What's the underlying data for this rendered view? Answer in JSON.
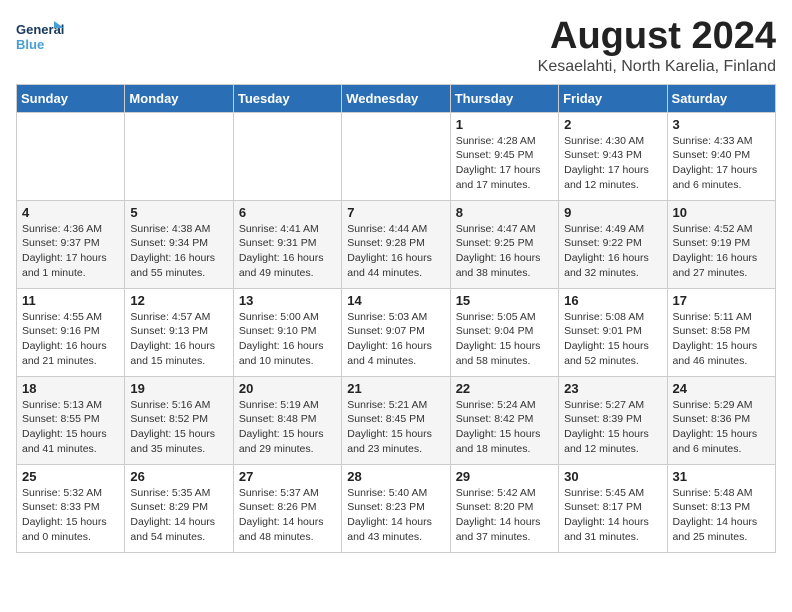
{
  "logo": {
    "line1": "General",
    "line2": "Blue"
  },
  "title": "August 2024",
  "subtitle": "Kesaelahti, North Karelia, Finland",
  "weekdays": [
    "Sunday",
    "Monday",
    "Tuesday",
    "Wednesday",
    "Thursday",
    "Friday",
    "Saturday"
  ],
  "weeks": [
    [
      {
        "day": "",
        "info": ""
      },
      {
        "day": "",
        "info": ""
      },
      {
        "day": "",
        "info": ""
      },
      {
        "day": "",
        "info": ""
      },
      {
        "day": "1",
        "info": "Sunrise: 4:28 AM\nSunset: 9:45 PM\nDaylight: 17 hours\nand 17 minutes."
      },
      {
        "day": "2",
        "info": "Sunrise: 4:30 AM\nSunset: 9:43 PM\nDaylight: 17 hours\nand 12 minutes."
      },
      {
        "day": "3",
        "info": "Sunrise: 4:33 AM\nSunset: 9:40 PM\nDaylight: 17 hours\nand 6 minutes."
      }
    ],
    [
      {
        "day": "4",
        "info": "Sunrise: 4:36 AM\nSunset: 9:37 PM\nDaylight: 17 hours\nand 1 minute."
      },
      {
        "day": "5",
        "info": "Sunrise: 4:38 AM\nSunset: 9:34 PM\nDaylight: 16 hours\nand 55 minutes."
      },
      {
        "day": "6",
        "info": "Sunrise: 4:41 AM\nSunset: 9:31 PM\nDaylight: 16 hours\nand 49 minutes."
      },
      {
        "day": "7",
        "info": "Sunrise: 4:44 AM\nSunset: 9:28 PM\nDaylight: 16 hours\nand 44 minutes."
      },
      {
        "day": "8",
        "info": "Sunrise: 4:47 AM\nSunset: 9:25 PM\nDaylight: 16 hours\nand 38 minutes."
      },
      {
        "day": "9",
        "info": "Sunrise: 4:49 AM\nSunset: 9:22 PM\nDaylight: 16 hours\nand 32 minutes."
      },
      {
        "day": "10",
        "info": "Sunrise: 4:52 AM\nSunset: 9:19 PM\nDaylight: 16 hours\nand 27 minutes."
      }
    ],
    [
      {
        "day": "11",
        "info": "Sunrise: 4:55 AM\nSunset: 9:16 PM\nDaylight: 16 hours\nand 21 minutes."
      },
      {
        "day": "12",
        "info": "Sunrise: 4:57 AM\nSunset: 9:13 PM\nDaylight: 16 hours\nand 15 minutes."
      },
      {
        "day": "13",
        "info": "Sunrise: 5:00 AM\nSunset: 9:10 PM\nDaylight: 16 hours\nand 10 minutes."
      },
      {
        "day": "14",
        "info": "Sunrise: 5:03 AM\nSunset: 9:07 PM\nDaylight: 16 hours\nand 4 minutes."
      },
      {
        "day": "15",
        "info": "Sunrise: 5:05 AM\nSunset: 9:04 PM\nDaylight: 15 hours\nand 58 minutes."
      },
      {
        "day": "16",
        "info": "Sunrise: 5:08 AM\nSunset: 9:01 PM\nDaylight: 15 hours\nand 52 minutes."
      },
      {
        "day": "17",
        "info": "Sunrise: 5:11 AM\nSunset: 8:58 PM\nDaylight: 15 hours\nand 46 minutes."
      }
    ],
    [
      {
        "day": "18",
        "info": "Sunrise: 5:13 AM\nSunset: 8:55 PM\nDaylight: 15 hours\nand 41 minutes."
      },
      {
        "day": "19",
        "info": "Sunrise: 5:16 AM\nSunset: 8:52 PM\nDaylight: 15 hours\nand 35 minutes."
      },
      {
        "day": "20",
        "info": "Sunrise: 5:19 AM\nSunset: 8:48 PM\nDaylight: 15 hours\nand 29 minutes."
      },
      {
        "day": "21",
        "info": "Sunrise: 5:21 AM\nSunset: 8:45 PM\nDaylight: 15 hours\nand 23 minutes."
      },
      {
        "day": "22",
        "info": "Sunrise: 5:24 AM\nSunset: 8:42 PM\nDaylight: 15 hours\nand 18 minutes."
      },
      {
        "day": "23",
        "info": "Sunrise: 5:27 AM\nSunset: 8:39 PM\nDaylight: 15 hours\nand 12 minutes."
      },
      {
        "day": "24",
        "info": "Sunrise: 5:29 AM\nSunset: 8:36 PM\nDaylight: 15 hours\nand 6 minutes."
      }
    ],
    [
      {
        "day": "25",
        "info": "Sunrise: 5:32 AM\nSunset: 8:33 PM\nDaylight: 15 hours\nand 0 minutes."
      },
      {
        "day": "26",
        "info": "Sunrise: 5:35 AM\nSunset: 8:29 PM\nDaylight: 14 hours\nand 54 minutes."
      },
      {
        "day": "27",
        "info": "Sunrise: 5:37 AM\nSunset: 8:26 PM\nDaylight: 14 hours\nand 48 minutes."
      },
      {
        "day": "28",
        "info": "Sunrise: 5:40 AM\nSunset: 8:23 PM\nDaylight: 14 hours\nand 43 minutes."
      },
      {
        "day": "29",
        "info": "Sunrise: 5:42 AM\nSunset: 8:20 PM\nDaylight: 14 hours\nand 37 minutes."
      },
      {
        "day": "30",
        "info": "Sunrise: 5:45 AM\nSunset: 8:17 PM\nDaylight: 14 hours\nand 31 minutes."
      },
      {
        "day": "31",
        "info": "Sunrise: 5:48 AM\nSunset: 8:13 PM\nDaylight: 14 hours\nand 25 minutes."
      }
    ]
  ]
}
